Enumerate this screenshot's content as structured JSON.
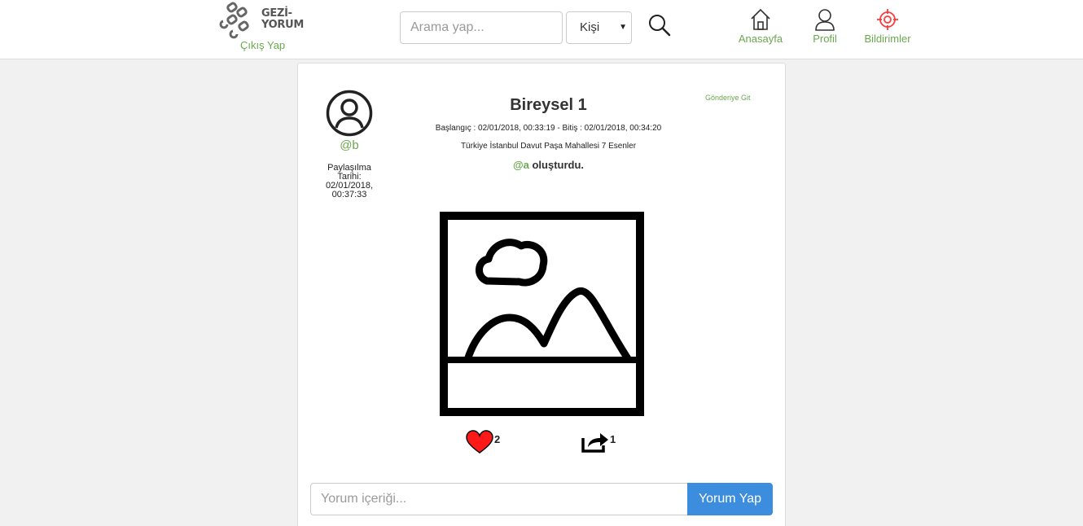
{
  "header": {
    "logo_line1": "GEZİ-",
    "logo_line2": "YORUM",
    "logout_label": "Çıkış Yap",
    "search_placeholder": "Arama yap...",
    "search_type_selected": "Kişi",
    "nav": {
      "home_label": "Anasayfa",
      "profile_label": "Profil",
      "notifications_label": "Bildirimler"
    },
    "icons": {
      "search": "search-icon",
      "home": "home-icon",
      "profile": "user-icon",
      "notifications": "crosshair-icon"
    }
  },
  "post": {
    "author_handle": "@b",
    "share_date_label": "Paylaşılma Tarihi:",
    "share_date_value": "02/01/2018, 00:37:33",
    "title": "Bireysel 1",
    "dates_text": "Başlangıç : 02/01/2018, 00:33:19 - Bitiş : 02/01/2018, 00:34:20",
    "location": "Türkiye İstanbul Davut Paşa Mahallesi 7 Esenler",
    "creator_mention": "@a",
    "creator_suffix": " oluşturdu.",
    "go_to_post_label": "Gönderiye Git",
    "like_count": "2",
    "share_count": "1",
    "icons": {
      "avatar": "user-circle-icon",
      "image": "image-placeholder-icon",
      "like": "heart-icon",
      "share": "share-icon"
    }
  },
  "comment": {
    "placeholder": "Yorum içeriği...",
    "submit_label": "Yorum Yap"
  },
  "colors": {
    "accent_green": "#6aa84f",
    "button_blue": "#3c8dde",
    "heart_red": "#ff1a1a",
    "notification_red": "#ff3b3b"
  }
}
